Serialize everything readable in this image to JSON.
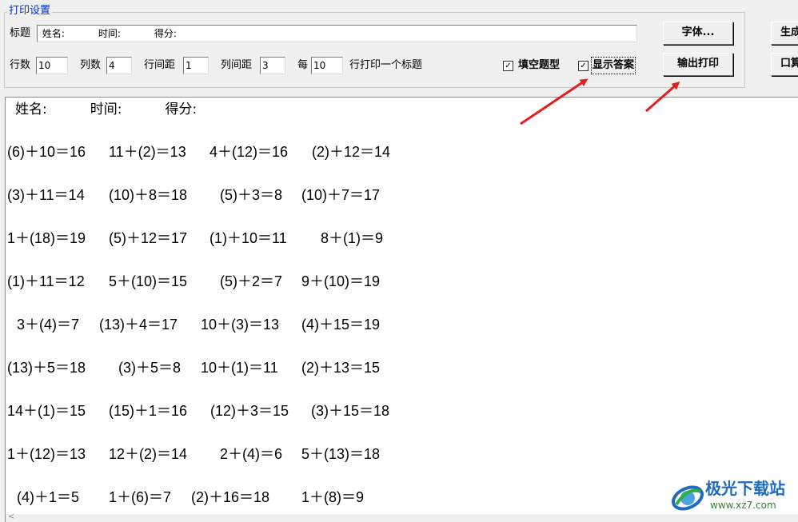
{
  "settings": {
    "group_title": "打印设置",
    "title_label": "标题",
    "title_value": " 姓名:           时间:           得分:",
    "rows_label": "行数",
    "rows_value": "10",
    "cols_label": "列数",
    "cols_value": "4",
    "row_spacing_label": "行间距",
    "row_spacing_value": "1",
    "col_spacing_label": "列间距",
    "col_spacing_value": "3",
    "every_label": "每",
    "every_value": "10",
    "every_suffix": "行打印一个标题",
    "fill_blank_label": "填空题型",
    "fill_blank_checked": true,
    "show_answer_label": "显示答案",
    "show_answer_checked": true,
    "font_button": "字体...",
    "print_button": "输出打印"
  },
  "right_buttons": {
    "generate": "生成",
    "oral": "口算"
  },
  "preview": {
    "header": "姓名:          时间:          得分:",
    "rows": [
      [
        "(6)＋10＝16",
        "11＋(2)＝13",
        "4＋(12)＝16",
        "(2)＋12＝14"
      ],
      [
        "(3)＋11＝14",
        "(10)＋8＝18",
        "(5)＋3＝8",
        "(10)＋7＝17"
      ],
      [
        "1＋(18)＝19",
        "(5)＋12＝17",
        "(1)＋10＝11",
        "8＋(1)＝9"
      ],
      [
        "(1)＋11＝12",
        "5＋(10)＝15",
        "(5)＋2＝7",
        "9＋(10)＝19"
      ],
      [
        "3＋(4)＝7",
        "(13)＋4＝17",
        "10＋(3)＝13",
        "(4)＋15＝19"
      ],
      [
        "(13)＋5＝18",
        "(3)＋5＝8",
        "10＋(1)＝11",
        "(2)＋13＝15"
      ],
      [
        "14＋(1)＝15",
        "(15)＋1＝16",
        "(12)＋3＝15",
        "(3)＋15＝18"
      ],
      [
        "1＋(12)＝13",
        "12＋(2)＝14",
        "2＋(4)＝6",
        "5＋(13)＝18"
      ],
      [
        "(4)＋1＝5",
        "1＋(6)＝7",
        "(2)＋16＝18",
        "1＋(8)＝9"
      ]
    ]
  },
  "watermark": {
    "name": "极光下载站",
    "url": "www.xz7.com"
  },
  "colors": {
    "annotation_arrow": "#e02020",
    "group_title": "#0033cc"
  }
}
